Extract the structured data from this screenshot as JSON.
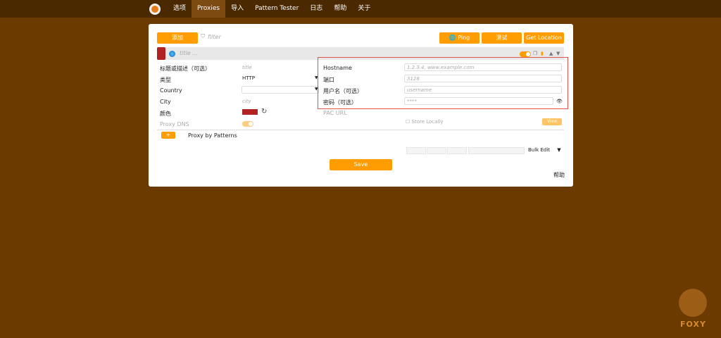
{
  "nav": {
    "items": [
      "选项",
      "Proxies",
      "导入",
      "Pattern Tester",
      "日志",
      "帮助",
      "关于"
    ],
    "active_index": 1
  },
  "toolbar": {
    "add_label": "添加",
    "filter_placeholder": "filter",
    "ping_label": "Ping",
    "test_label": "测试",
    "get_location_label": "Get Location"
  },
  "proxy": {
    "title_placeholder": "title ...",
    "left_fields": {
      "title_label": "标题或描述（可选）",
      "title_placeholder": "title",
      "type_label": "类型",
      "type_value": "HTTP",
      "country_label": "Country",
      "city_label": "City",
      "city_placeholder": "city",
      "color_label": "颜色",
      "proxy_dns_label": "Proxy DNS"
    },
    "right_fields": {
      "hostname_label": "Hostname",
      "hostname_placeholder": "1.2.3.4, www.example.com",
      "port_label": "端口",
      "port_placeholder": "3128",
      "username_label": "用户名（可选）",
      "username_placeholder": "username",
      "password_label": "密码（可选）",
      "password_placeholder": "****",
      "pac_label": "PAC URL",
      "store_locally_label": "Store Locally",
      "view_label": "View"
    },
    "color_value": "#b22222",
    "patterns": {
      "add_label": "+",
      "label": "Proxy by Patterns"
    }
  },
  "bottom": {
    "bulk_edit_label": "Bulk Edit",
    "save_label": "Save",
    "help_label": "帮助"
  },
  "watermark": {
    "text": "FOXY"
  }
}
